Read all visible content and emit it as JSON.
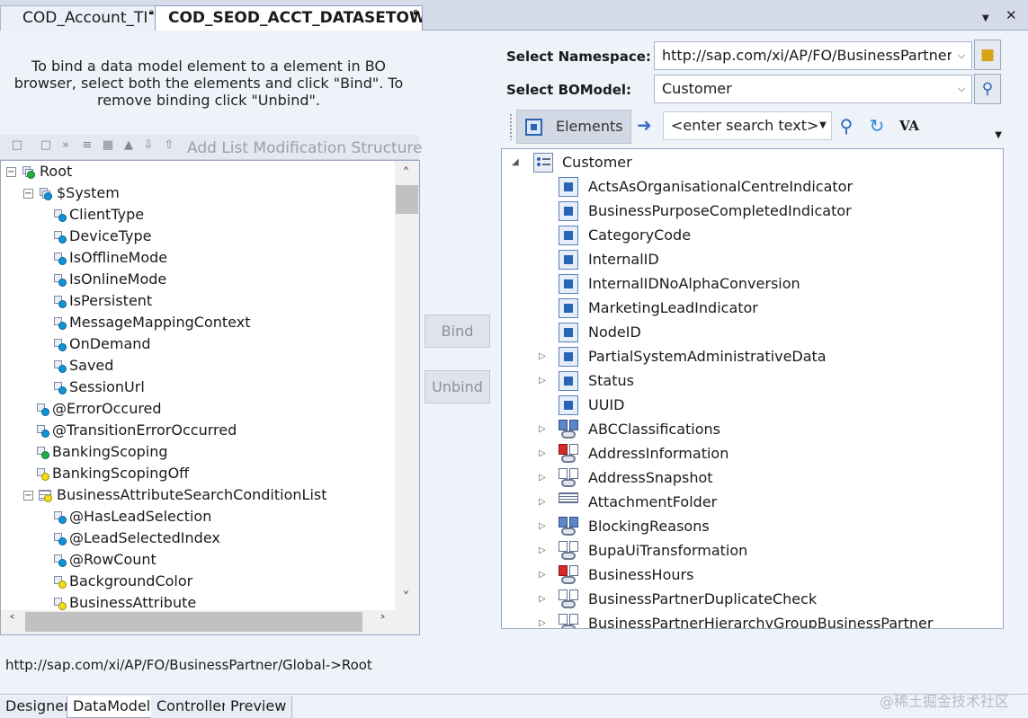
{
  "window": {
    "tabs": [
      {
        "label": "COD_Account_TI",
        "locked": true
      },
      {
        "label": "COD_SEOD_ACCT_DATASETOWL",
        "locked": true,
        "active": true
      }
    ]
  },
  "left": {
    "instructions": "To bind a data model element to a element in BO browser, select both the elements and click \"Bind\". To remove binding click \"Unbind\".",
    "toolbar": {
      "icons": [
        "new-icon",
        "delete-icon",
        "move-icon",
        "filter-icon",
        "structure-icon",
        "hierarchy-icon",
        "expand-all-icon",
        "collapse-all-icon"
      ],
      "add_list_label": "Add List Modification Structure"
    },
    "tree": [
      {
        "label": "Root",
        "level": 0,
        "expander": "minus",
        "icon": "structure",
        "dot": "green"
      },
      {
        "label": "$System",
        "level": 1,
        "expander": "minus",
        "icon": "structure",
        "dot": "blue"
      },
      {
        "label": "ClientType",
        "level": 2,
        "icon": "field",
        "dot": "blue"
      },
      {
        "label": "DeviceType",
        "level": 2,
        "icon": "field",
        "dot": "blue"
      },
      {
        "label": "IsOfflineMode",
        "level": 2,
        "icon": "field",
        "dot": "blue"
      },
      {
        "label": "IsOnlineMode",
        "level": 2,
        "icon": "field",
        "dot": "blue"
      },
      {
        "label": "IsPersistent",
        "level": 2,
        "icon": "field",
        "dot": "blue"
      },
      {
        "label": "MessageMappingContext",
        "level": 2,
        "icon": "field",
        "dot": "blue"
      },
      {
        "label": "OnDemand",
        "level": 2,
        "icon": "field",
        "dot": "blue"
      },
      {
        "label": "Saved",
        "level": 2,
        "icon": "field",
        "dot": "blue"
      },
      {
        "label": "SessionUrl",
        "level": 2,
        "icon": "field",
        "dot": "blue"
      },
      {
        "label": "@ErrorOccured",
        "level": 1,
        "icon": "field",
        "dot": "blue"
      },
      {
        "label": "@TransitionErrorOccurred",
        "level": 1,
        "icon": "field",
        "dot": "blue"
      },
      {
        "label": "BankingScoping",
        "level": 1,
        "icon": "field",
        "dot": "green"
      },
      {
        "label": "BankingScopingOff",
        "level": 1,
        "icon": "field",
        "dot": "yellow"
      },
      {
        "label": "BusinessAttributeSearchConditionList",
        "level": 1,
        "expander": "minus",
        "icon": "list",
        "dot": "yellow"
      },
      {
        "label": "@HasLeadSelection",
        "level": 2,
        "icon": "field",
        "dot": "blue"
      },
      {
        "label": "@LeadSelectedIndex",
        "level": 2,
        "icon": "field",
        "dot": "blue"
      },
      {
        "label": "@RowCount",
        "level": 2,
        "icon": "field",
        "dot": "blue"
      },
      {
        "label": "BackgroundColor",
        "level": 2,
        "icon": "field",
        "dot": "yellow"
      },
      {
        "label": "BusinessAttribute",
        "level": 2,
        "icon": "field",
        "dot": "yellow"
      }
    ]
  },
  "center": {
    "bind_label": "Bind",
    "unbind_label": "Unbind"
  },
  "right": {
    "namespace_label": "Select Namespace:",
    "namespace_value": "http://sap.com/xi/AP/FO/BusinessPartner/G",
    "bomodel_label": "Select BOModel:",
    "bomodel_value": "Customer",
    "elements_label": "Elements",
    "search_placeholder": "<enter search text>",
    "va_label": "VA",
    "root_label": "Customer",
    "items": [
      {
        "label": "ActsAsOrganisationalCentreIndicator",
        "icon": "element",
        "expandable": false
      },
      {
        "label": "BusinessPurposeCompletedIndicator",
        "icon": "element",
        "expandable": false
      },
      {
        "label": "CategoryCode",
        "icon": "element",
        "expandable": false
      },
      {
        "label": "InternalID",
        "icon": "element",
        "expandable": false
      },
      {
        "label": "InternalIDNoAlphaConversion",
        "icon": "element",
        "expandable": false
      },
      {
        "label": "MarketingLeadIndicator",
        "icon": "element",
        "expandable": false
      },
      {
        "label": "NodeID",
        "icon": "element",
        "expandable": false
      },
      {
        "label": "PartialSystemAdministrativeData",
        "icon": "element",
        "expandable": true
      },
      {
        "label": "Status",
        "icon": "element",
        "expandable": true
      },
      {
        "label": "UUID",
        "icon": "element",
        "expandable": false
      },
      {
        "label": "ABCClassifications",
        "icon": "assoc-blue",
        "expandable": true
      },
      {
        "label": "AddressInformation",
        "icon": "assoc-red",
        "expandable": true
      },
      {
        "label": "AddressSnapshot",
        "icon": "assoc",
        "expandable": true
      },
      {
        "label": "AttachmentFolder",
        "icon": "assoc-doc",
        "expandable": true
      },
      {
        "label": "BlockingReasons",
        "icon": "assoc-blue",
        "expandable": true
      },
      {
        "label": "BupaUiTransformation",
        "icon": "assoc",
        "expandable": true
      },
      {
        "label": "BusinessHours",
        "icon": "assoc-red",
        "expandable": true
      },
      {
        "label": "BusinessPartnerDuplicateCheck",
        "icon": "assoc",
        "expandable": true
      },
      {
        "label": "BusinessPartnerHierarchyGroupBusinessPartner",
        "icon": "assoc",
        "expandable": true
      }
    ]
  },
  "footer": {
    "path": "http://sap.com/xi/AP/FO/BusinessPartner/Global->Root",
    "tabs": [
      "Designer",
      "DataModel",
      "Controller",
      "Preview"
    ],
    "active_tab": "DataModel",
    "watermark": "@稀土掘金技术社区"
  }
}
